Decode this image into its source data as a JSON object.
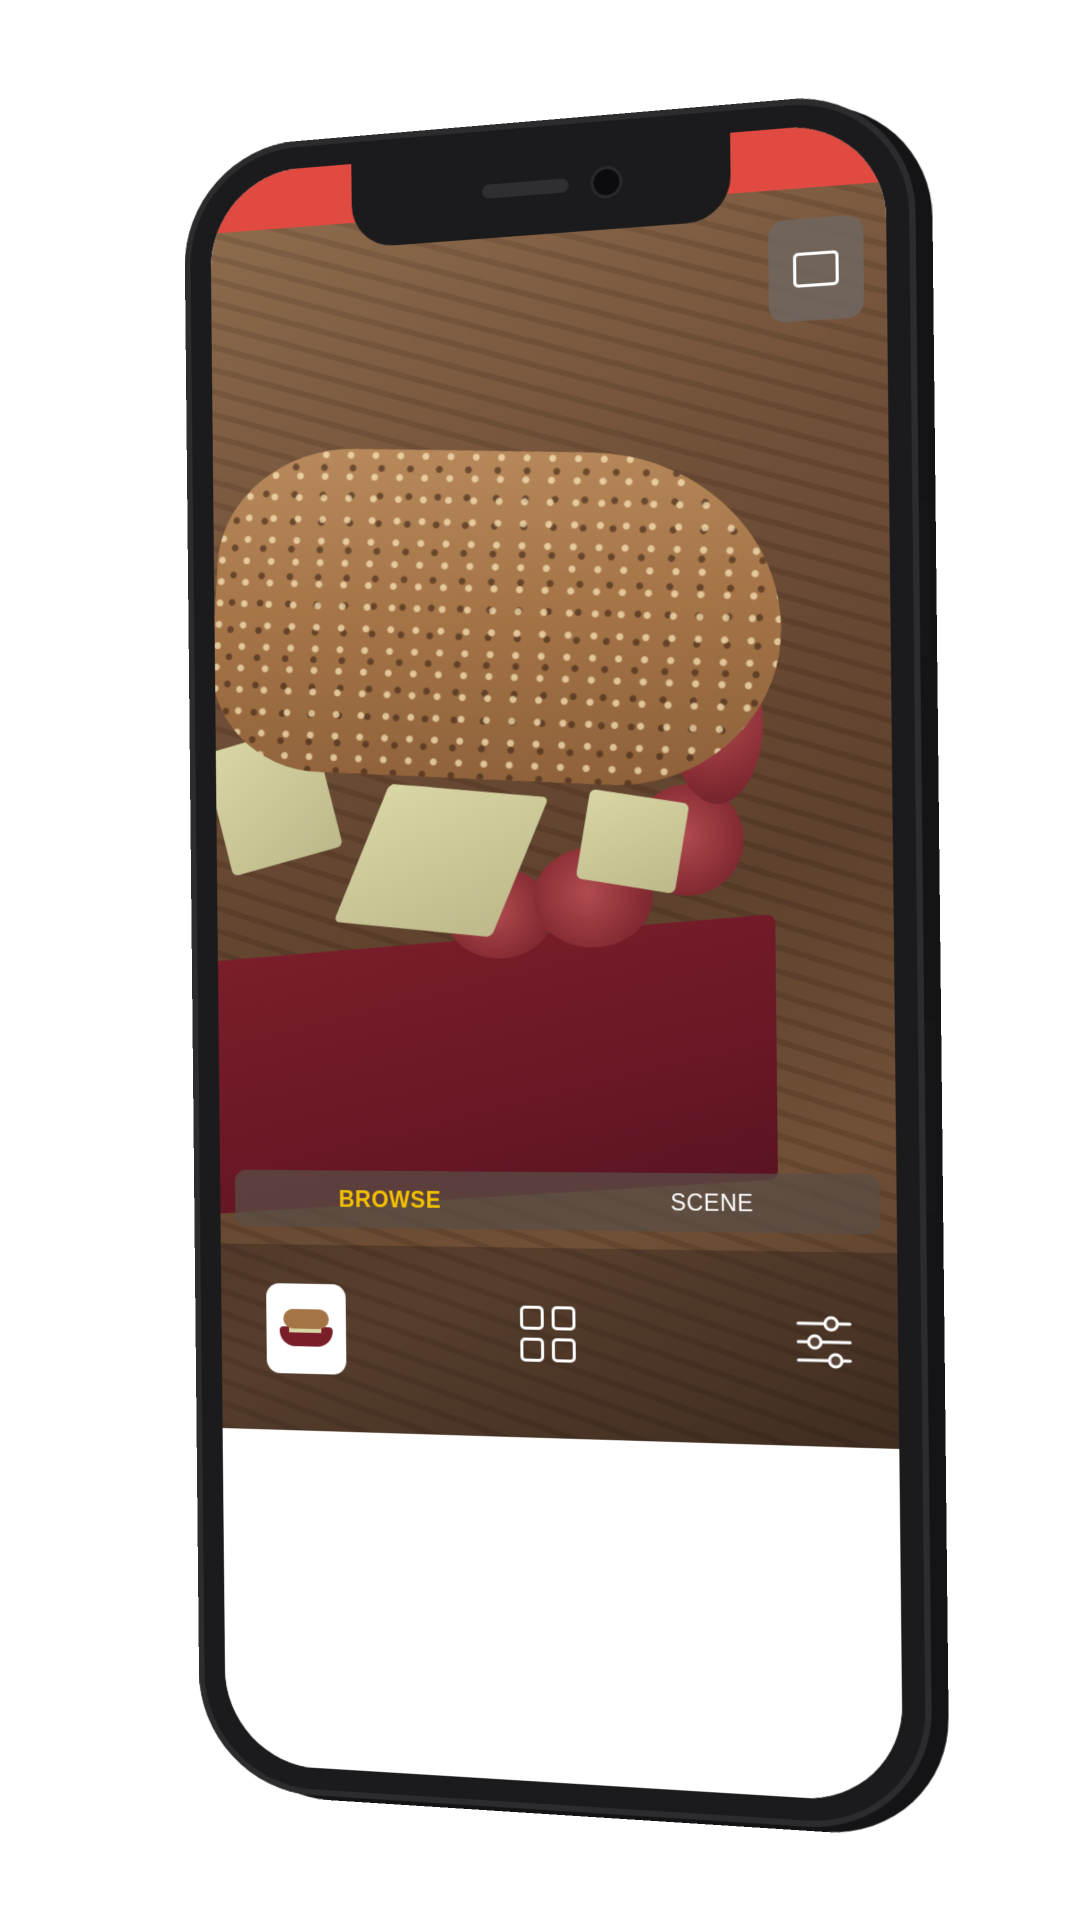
{
  "app": {
    "status_bar_color": "#e04a40",
    "accent_color": "#f2c200"
  },
  "overlay": {
    "screen_mode_icon": "screen-mode-icon"
  },
  "mode_tabs": [
    {
      "label": "BROWSE",
      "active": true
    },
    {
      "label": "SCENE",
      "active": false
    }
  ],
  "toolbar": {
    "thumbnail_icon": "sandwich-thumbnail-icon",
    "grid_icon": "grid-icon",
    "settings_icon": "sliders-icon"
  }
}
